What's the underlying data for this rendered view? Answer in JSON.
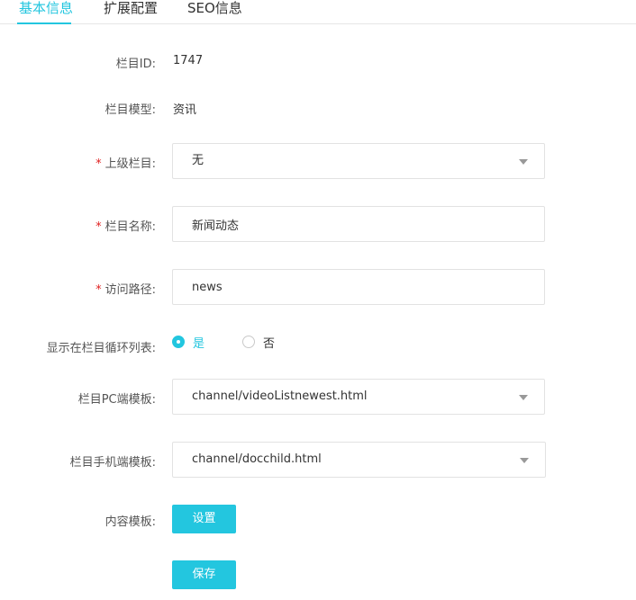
{
  "tabs": [
    {
      "label": "基本信息",
      "active": true
    },
    {
      "label": "扩展配置",
      "active": false
    },
    {
      "label": "SEO信息",
      "active": false
    }
  ],
  "form": {
    "column_id": {
      "label": "栏目ID:",
      "value": "1747"
    },
    "column_model": {
      "label": "栏目模型:",
      "value": "资讯"
    },
    "parent_column": {
      "label": "上级栏目:",
      "value": "无",
      "required": true
    },
    "column_name": {
      "label": "栏目名称:",
      "value": "新闻动态",
      "required": true
    },
    "access_path": {
      "label": "访问路径:",
      "value": "news",
      "required": true
    },
    "show_in_list": {
      "label": "显示在栏目循环列表:",
      "options": [
        "是",
        "否"
      ],
      "selected": "是"
    },
    "pc_template": {
      "label": "栏目PC端模板:",
      "value": "channel/videoListnewest.html"
    },
    "mobile_template": {
      "label": "栏目手机端模板:",
      "value": "channel/docchild.html"
    },
    "content_template": {
      "label": "内容模板:",
      "button_label": "设置"
    }
  },
  "save_button": {
    "label": "保存"
  },
  "colors": {
    "accent": "#23c6df",
    "required": "#e02020"
  }
}
